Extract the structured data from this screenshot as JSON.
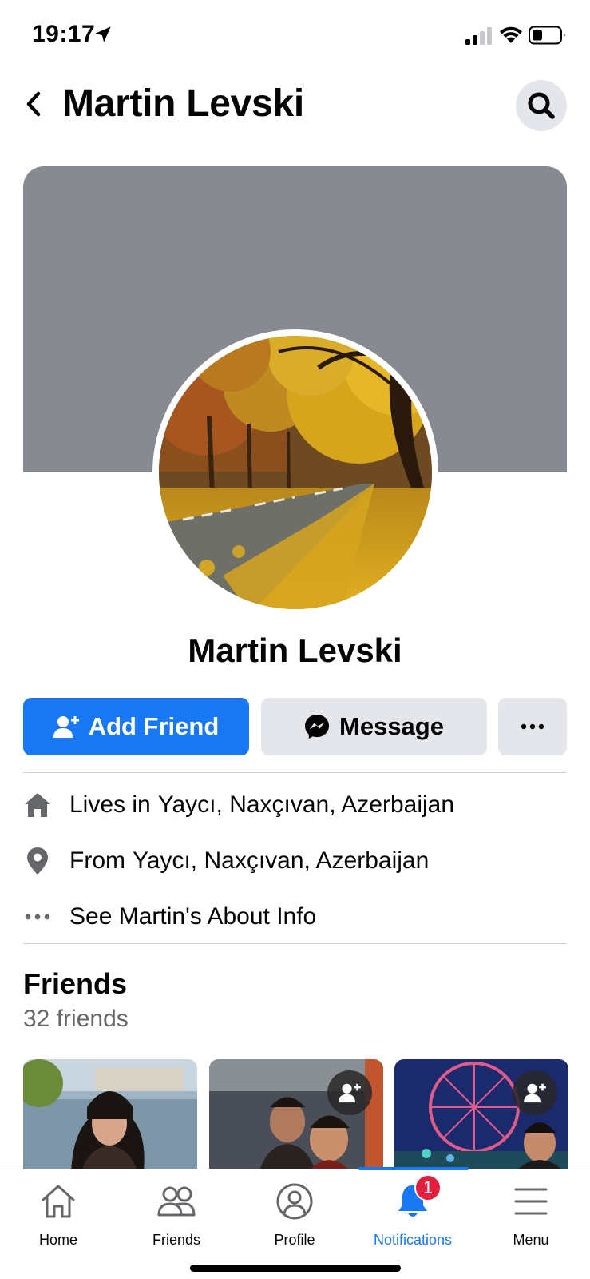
{
  "status_bar": {
    "time": "19:17",
    "icons": [
      "location-arrow-icon",
      "signal-icon",
      "wifi-icon",
      "battery-icon"
    ]
  },
  "header": {
    "title": "Martin Levski",
    "back_icon": "chevron-left-icon",
    "search_icon": "search-icon"
  },
  "profile": {
    "name": "Martin Levski",
    "avatar_description": "autumn-road-photo"
  },
  "actions": {
    "add_friend": "Add Friend",
    "message": "Message",
    "more_icon": "more-dots-icon"
  },
  "intro": {
    "lives_prefix": "Lives in",
    "lives_place": "Yaycı, Naxçıvan, Azerbaijan",
    "from_prefix": "From",
    "from_place": "Yaycı, Naxçıvan, Azerbaijan",
    "about_link": "See Martin's About Info"
  },
  "friends": {
    "title": "Friends",
    "count": "32 friends"
  },
  "tabbar": {
    "tabs": [
      {
        "label": "Home",
        "icon": "home-icon"
      },
      {
        "label": "Friends",
        "icon": "friends-icon"
      },
      {
        "label": "Profile",
        "icon": "profile-icon"
      },
      {
        "label": "Notifications",
        "icon": "bell-icon",
        "badge": "1",
        "active": true
      },
      {
        "label": "Menu",
        "icon": "hamburger-menu-icon"
      }
    ]
  },
  "colors": {
    "accent": "#1877f2",
    "secondary_button": "#e4e6eb",
    "cover": "#878a90",
    "badge": "#e41e3f",
    "muted_text": "#65676b"
  }
}
